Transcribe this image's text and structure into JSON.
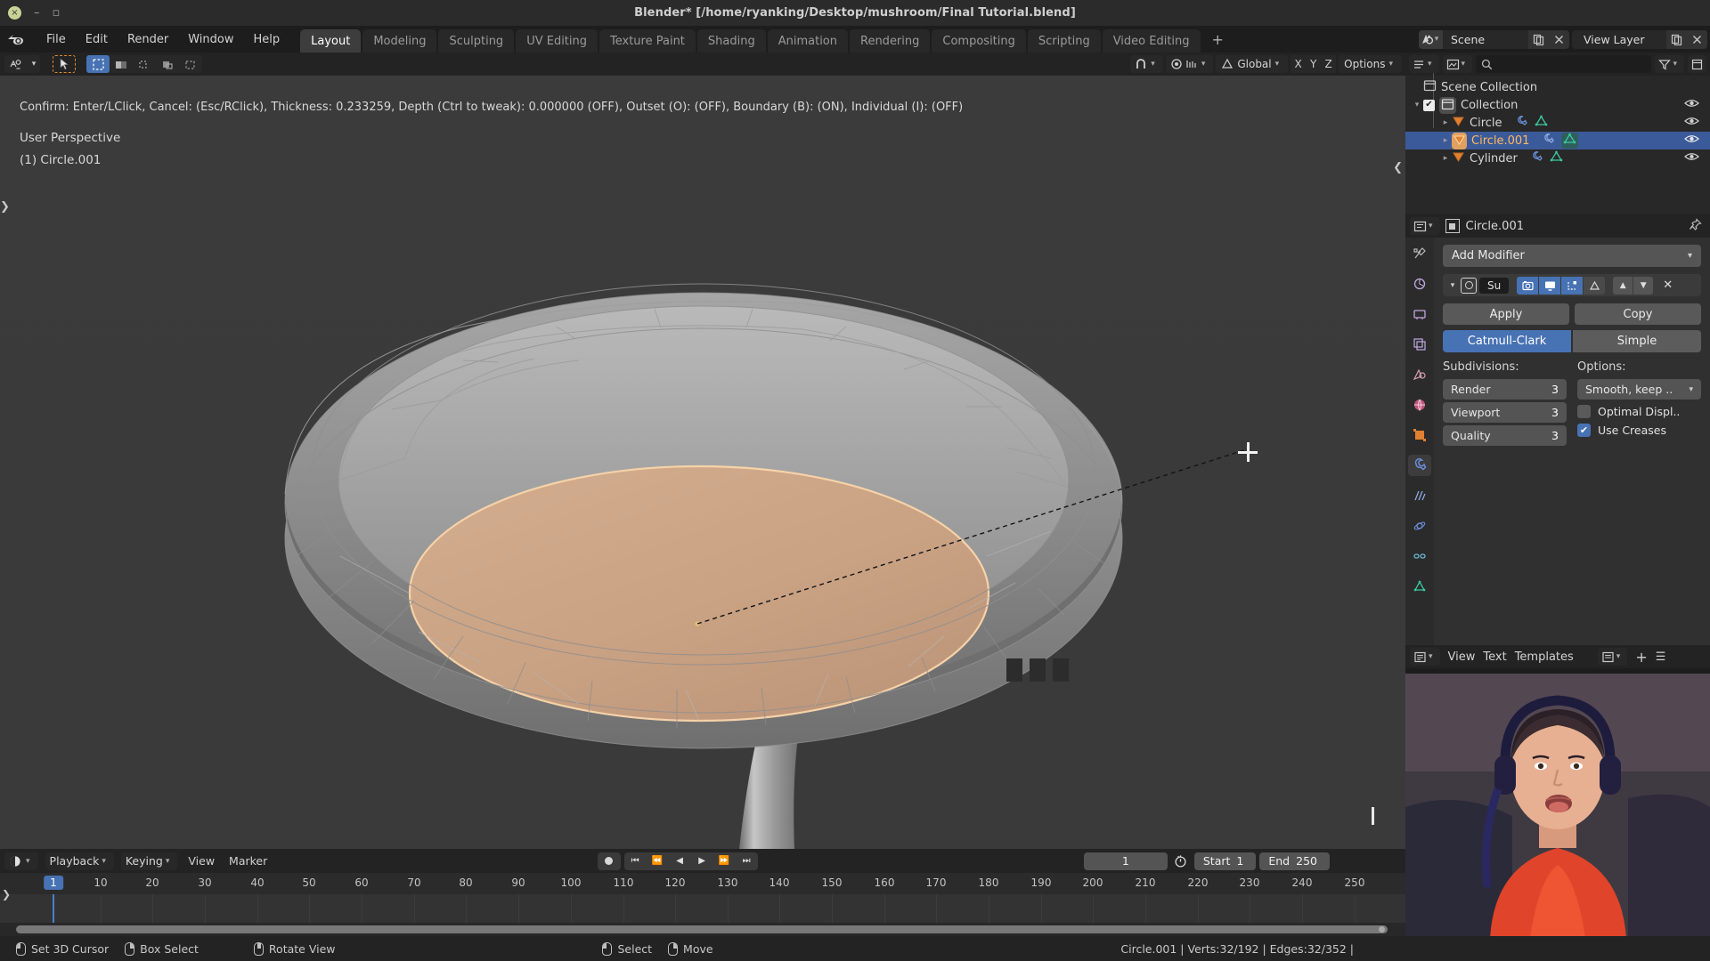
{
  "window": {
    "title": "Blender* [/home/ryanking/Desktop/mushroom/Final Tutorial.blend]",
    "close_glyph": "×",
    "minimize_glyph": "–",
    "maximize_glyph": "▫"
  },
  "topbar": {
    "menus": [
      "File",
      "Edit",
      "Render",
      "Window",
      "Help"
    ],
    "workspaces": [
      {
        "label": "Layout",
        "active": true
      },
      {
        "label": "Modeling",
        "active": false
      },
      {
        "label": "Sculpting",
        "active": false
      },
      {
        "label": "UV Editing",
        "active": false
      },
      {
        "label": "Texture Paint",
        "active": false
      },
      {
        "label": "Shading",
        "active": false
      },
      {
        "label": "Animation",
        "active": false
      },
      {
        "label": "Rendering",
        "active": false
      },
      {
        "label": "Compositing",
        "active": false
      },
      {
        "label": "Scripting",
        "active": false
      },
      {
        "label": "Video Editing",
        "active": false
      }
    ],
    "add_workspace_label": "+",
    "scene_name": "Scene",
    "view_layer_name": "View Layer"
  },
  "viewport": {
    "header": {
      "mode_label": "",
      "transform_orientation": "Global",
      "options_label": "Options",
      "axis_x": "X",
      "axis_y": "Y",
      "axis_z": "Z"
    },
    "hud": {
      "status": "Confirm: Enter/LClick, Cancel: (Esc/RClick), Thickness: 0.233259, Depth (Ctrl to tweak): 0.000000 (OFF), Outset (O): (OFF), Boundary (B): (ON), Individual (I): (OFF)",
      "perspective": "User Perspective",
      "active_object": "(1) Circle.001"
    },
    "colors": {
      "background": "#3b3b3b",
      "cap_face": "#c9a385",
      "mesh_wire": "#8d8d8d",
      "selected_outline": "#f7cfa0"
    }
  },
  "outliner": {
    "search_placeholder": "",
    "rows": [
      {
        "label": "Scene Collection",
        "indent": 1,
        "type": "scene-collection",
        "tri": "",
        "checkbox": false,
        "eye": false,
        "selected": false,
        "icons": []
      },
      {
        "label": "Collection",
        "indent": 1,
        "type": "collection",
        "tri": "▾",
        "checkbox": true,
        "eye": true,
        "selected": false,
        "icons": []
      },
      {
        "label": "Circle",
        "indent": 2,
        "type": "mesh-object",
        "tri": "▸",
        "checkbox": false,
        "eye": true,
        "selected": false,
        "icons": [
          "wrench-icon",
          "mesh-data-icon"
        ]
      },
      {
        "label": "Circle.001",
        "indent": 2,
        "type": "mesh-object",
        "tri": "▸",
        "checkbox": false,
        "eye": true,
        "selected": true,
        "icons": [
          "wrench-icon",
          "mesh-data-icon"
        ]
      },
      {
        "label": "Cylinder",
        "indent": 2,
        "type": "mesh-object",
        "tri": "▸",
        "checkbox": false,
        "eye": true,
        "selected": false,
        "icons": [
          "wrench-icon",
          "mesh-data-icon"
        ]
      }
    ]
  },
  "properties": {
    "breadcrumb_object": "Circle.001",
    "add_modifier_label": "Add Modifier",
    "modifier": {
      "short_name": "Su",
      "display_toggles": [
        {
          "name": "render-toggle",
          "glyph": "◉",
          "on": true
        },
        {
          "name": "realtime-toggle",
          "glyph": "▣",
          "on": true
        },
        {
          "name": "edit-mode-toggle",
          "glyph": "◱",
          "on": true
        },
        {
          "name": "on-cage-toggle",
          "glyph": "△",
          "on": false
        }
      ],
      "move_up_glyph": "▲",
      "move_down_glyph": "▼",
      "delete_glyph": "✕",
      "apply_label": "Apply",
      "copy_label": "Copy",
      "type_options": [
        {
          "label": "Catmull-Clark",
          "active": true
        },
        {
          "label": "Simple",
          "active": false
        }
      ],
      "subdivisions_title": "Subdivisions:",
      "options_title": "Options:",
      "fields": [
        {
          "label": "Render",
          "value": "3"
        },
        {
          "label": "Viewport",
          "value": "3"
        },
        {
          "label": "Quality",
          "value": "3"
        }
      ],
      "uv_smooth": "Smooth, keep ..",
      "checkboxes": [
        {
          "label": "Optimal Displ..",
          "checked": false
        },
        {
          "label": "Use Creases",
          "checked": true
        }
      ]
    },
    "tab_icons": [
      "tool-icon",
      "render-icon",
      "output-icon",
      "view-layer-icon",
      "scene-icon",
      "world-icon",
      "object-icon",
      "modifier-icon",
      "particles-icon",
      "physics-icon",
      "constraints-icon",
      "data-icon"
    ],
    "active_tab": "modifier-icon"
  },
  "text_editor": {
    "menus": [
      "View",
      "Text",
      "Templates"
    ],
    "new_glyph": "+"
  },
  "timeline": {
    "menus": [
      "Playback",
      "Keying",
      "View",
      "Marker"
    ],
    "playback_label": "Playback",
    "keying_label": "Keying",
    "view_label": "View",
    "marker_label": "Marker",
    "current_frame": "1",
    "start_label": "Start",
    "start_value": "1",
    "end_label": "End",
    "end_value": "250",
    "ticks": [
      "1",
      "10",
      "20",
      "30",
      "40",
      "50",
      "60",
      "70",
      "80",
      "90",
      "100",
      "110",
      "120",
      "130",
      "140",
      "150",
      "160",
      "170",
      "180",
      "190",
      "200",
      "210",
      "220",
      "230",
      "240",
      "250"
    ],
    "transport": [
      "⏮",
      "⏪",
      "◀",
      "▶",
      "⏩",
      "⏭"
    ]
  },
  "statusbar": {
    "hints": [
      {
        "mouse": "l",
        "label": "Set 3D Cursor"
      },
      {
        "mouse": "r",
        "label": "Box Select"
      },
      {
        "mouse": "m",
        "label": "Rotate View"
      },
      {
        "mouse": "l",
        "label": "Select"
      },
      {
        "mouse": "r",
        "label": "Move"
      }
    ],
    "stats": "Circle.001 | Verts:32/192 | Edges:32/352 |"
  }
}
